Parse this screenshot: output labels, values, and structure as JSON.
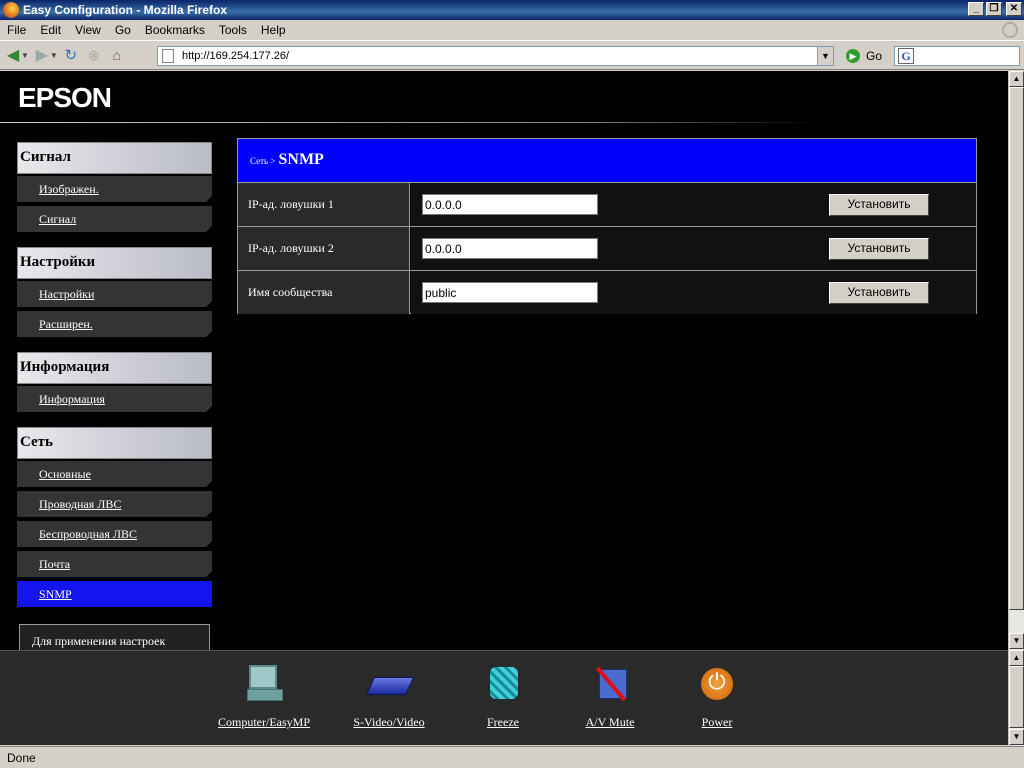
{
  "window": {
    "title": "Easy Configuration - Mozilla Firefox"
  },
  "menu": [
    "File",
    "Edit",
    "View",
    "Go",
    "Bookmarks",
    "Tools",
    "Help"
  ],
  "nav": {
    "url": "http://169.254.177.26/",
    "go_label": "Go",
    "search_placeholder": "",
    "icons": [
      "back-arrow-icon",
      "forward-arrow-icon",
      "reload-icon",
      "stop-icon",
      "home-icon"
    ]
  },
  "logo": "EPSON",
  "sidebar": {
    "groups": [
      {
        "title": "Сигнал",
        "items": [
          "Изображен.",
          "Сигнал"
        ]
      },
      {
        "title": "Настройки",
        "items": [
          "Настройки",
          "Расширен."
        ]
      },
      {
        "title": "Информация",
        "items": [
          "Информация"
        ]
      },
      {
        "title": "Сеть",
        "items": [
          "Основные",
          "Проводная ЛВС",
          "Беспроводная ЛВС",
          "Почта",
          "SNMP"
        ]
      }
    ],
    "active_item": "SNMP",
    "notice": "Для применения настроек"
  },
  "panel": {
    "breadcrumb": "Сеть >",
    "title": "SNMP",
    "rows": [
      {
        "label": "IP-ад. ловушки 1",
        "value": "0.0.0.0",
        "button": "Установить"
      },
      {
        "label": "IP-ад. ловушки 2",
        "value": "0.0.0.0",
        "button": "Установить"
      },
      {
        "label": "Имя сообщества",
        "value": "public",
        "button": "Установить"
      }
    ]
  },
  "bottom_tools": [
    {
      "label": "Computer/EasyMP",
      "icon": "computer-icon"
    },
    {
      "label": "S-Video/Video",
      "icon": "svideo-icon"
    },
    {
      "label": "Freeze",
      "icon": "freeze-icon"
    },
    {
      "label": "A/V Mute",
      "icon": "av-mute-icon"
    },
    {
      "label": "Power",
      "icon": "power-icon"
    }
  ],
  "status": "Done",
  "colors": {
    "active": "#1414ee",
    "panel_header": "#0000ff",
    "background": "#000000"
  }
}
